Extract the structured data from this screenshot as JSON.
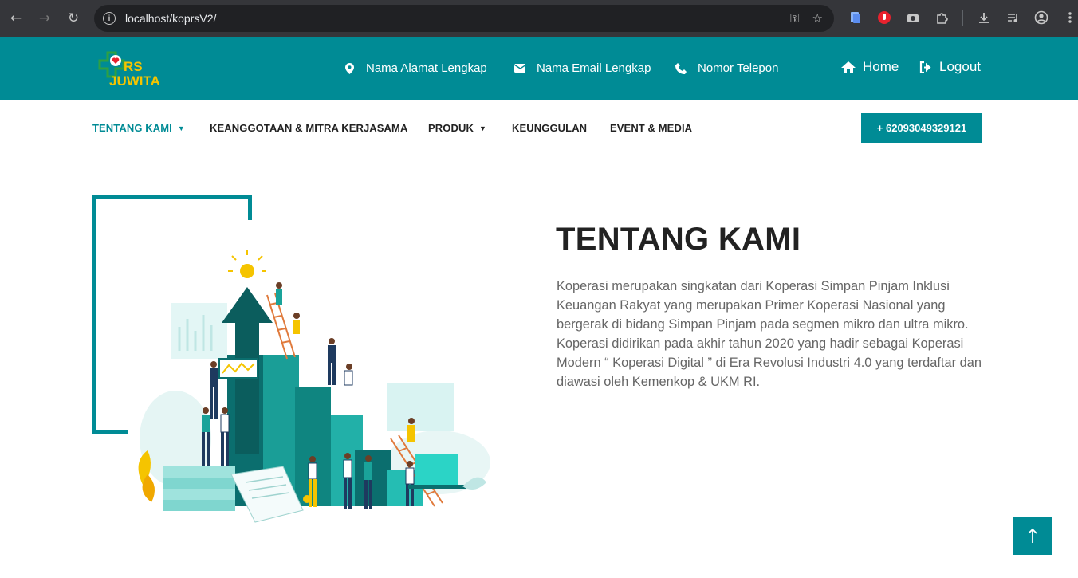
{
  "browser": {
    "url": "localhost/koprsV2/"
  },
  "header": {
    "logo_text_top": "RS",
    "logo_text_bottom": "JUWITA",
    "address": "Nama Alamat Lengkap",
    "email": "Nama Email Lengkap",
    "phone": "Nomor Telepon",
    "home_label": "Home",
    "logout_label": "Logout"
  },
  "nav": {
    "items": [
      {
        "label": "TENTANG KAMI",
        "active": true,
        "dropdown": true
      },
      {
        "label": "KEANGGOTAAN & MITRA KERJASAMA",
        "active": false,
        "dropdown": false
      },
      {
        "label": "PRODUK",
        "active": false,
        "dropdown": true
      },
      {
        "label": "KEUNGGULAN",
        "active": false,
        "dropdown": false
      },
      {
        "label": "EVENT & MEDIA",
        "active": false,
        "dropdown": false
      }
    ],
    "phone_button": "+ 62093049329121"
  },
  "about": {
    "title": "TENTANG KAMI",
    "text": "Koperasi merupakan singkatan dari Koperasi Simpan Pinjam Inklusi Keuangan Rakyat yang merupakan Primer Koperasi Nasional yang bergerak di bidang Simpan Pinjam pada segmen mikro dan ultra mikro. Koperasi didirikan pada akhir tahun 2020 yang hadir sebagai Koperasi Modern “ Koperasi Digital ” di Era Revolusi Industri 4.0 yang terdaftar dan diawasi oleh Kemenkop & UKM RI."
  },
  "colors": {
    "brand": "#008b95",
    "logo_yellow": "#f5c400",
    "logo_green": "#2ea043"
  }
}
